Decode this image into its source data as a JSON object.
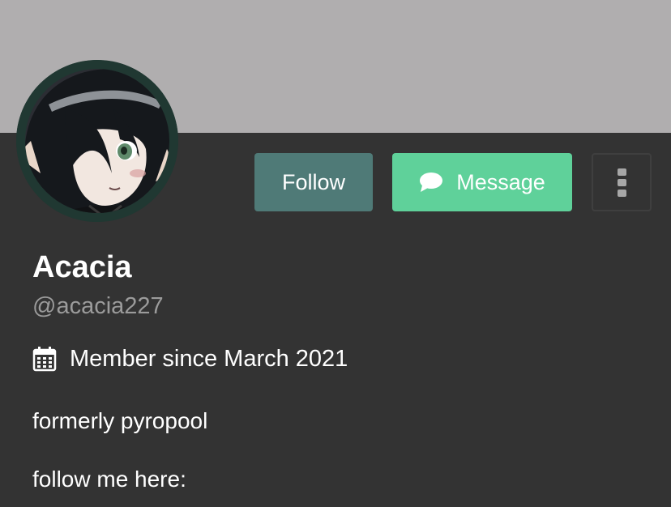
{
  "profile": {
    "display_name": "Acacia",
    "handle": "@acacia227",
    "member_since": "Member since March 2021",
    "bio": [
      "formerly pyropool",
      "follow me here:"
    ]
  },
  "actions": {
    "follow_label": "Follow",
    "message_label": "Message"
  },
  "icons": {
    "message": "chat-bubble-icon",
    "more": "vertical-dots-icon",
    "calendar": "calendar-icon",
    "avatar": "anime-character-avatar"
  },
  "colors": {
    "banner": "#b0aeaf",
    "background": "#333333",
    "follow_button": "#4f7a77",
    "message_button": "#5fd19a",
    "avatar_ring": "#203832",
    "handle_text": "#9b9b9b"
  }
}
